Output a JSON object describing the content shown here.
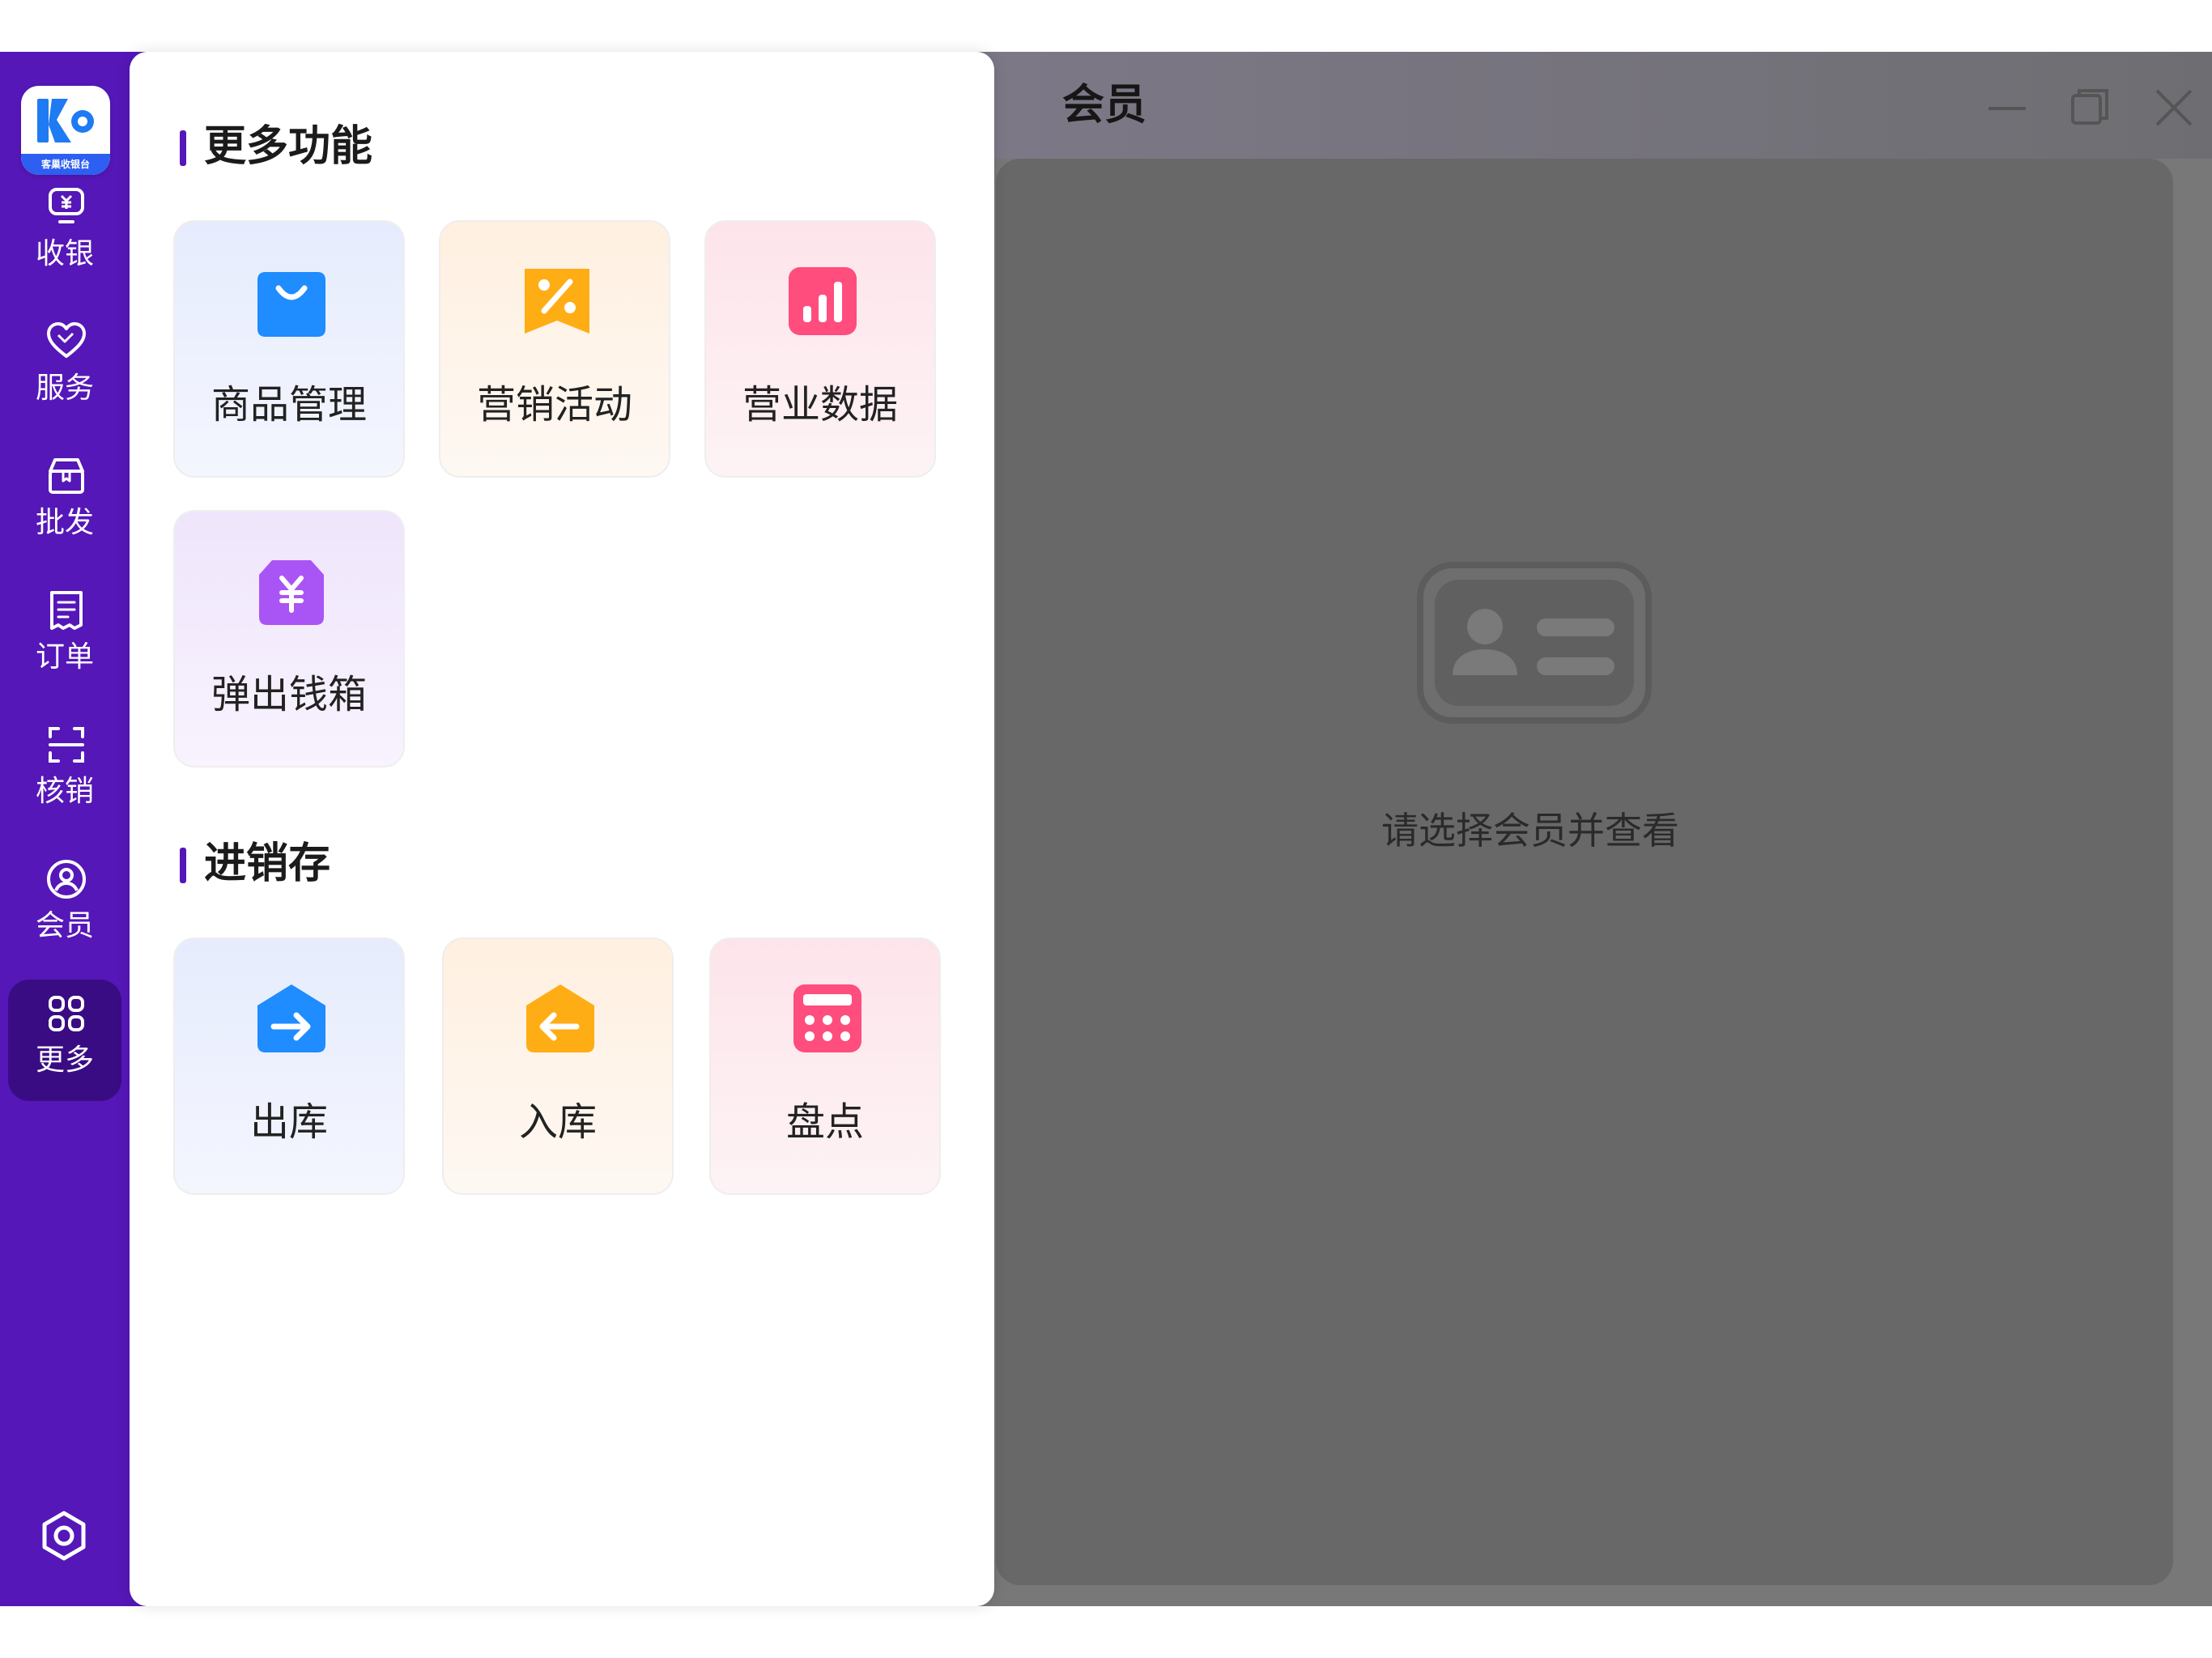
{
  "sidebar": {
    "logo_text": "客巢收银台",
    "items": [
      {
        "label": "收银",
        "icon": "cashier-icon"
      },
      {
        "label": "服务",
        "icon": "heart-icon"
      },
      {
        "label": "批发",
        "icon": "box-icon"
      },
      {
        "label": "订单",
        "icon": "order-icon"
      },
      {
        "label": "核销",
        "icon": "scan-icon"
      },
      {
        "label": "会员",
        "icon": "user-icon"
      },
      {
        "label": "更多",
        "icon": "grid-icon",
        "active": true
      }
    ],
    "settings_icon": "settings-icon"
  },
  "panel": {
    "section1": {
      "title": "更多功能",
      "tiles": [
        {
          "label": "商品管理",
          "icon": "shopping-bag-icon",
          "color": "#1f8cff"
        },
        {
          "label": "营销活动",
          "icon": "discount-ticket-icon",
          "color": "#ffad14"
        },
        {
          "label": "营业数据",
          "icon": "bar-chart-icon",
          "color": "#ff4d7d"
        },
        {
          "label": "弹出钱箱",
          "icon": "cash-box-icon",
          "color": "#a955f5"
        }
      ]
    },
    "section2": {
      "title": "进销存",
      "tiles": [
        {
          "label": "出库",
          "icon": "stock-out-icon",
          "color": "#1f8cff"
        },
        {
          "label": "入库",
          "icon": "stock-in-icon",
          "color": "#ffad14"
        },
        {
          "label": "盘点",
          "icon": "calculator-icon",
          "color": "#ff4d7d"
        }
      ]
    }
  },
  "window": {
    "title": "会员",
    "controls": [
      "minimize-icon",
      "restore-icon",
      "close-icon"
    ],
    "empty_text": "请选择会员并查看",
    "empty_icon": "member-card-icon"
  },
  "colors": {
    "sidebar": "#5517b8",
    "sidebar_active": "#3a0c84",
    "overlay_window": "#787878"
  }
}
